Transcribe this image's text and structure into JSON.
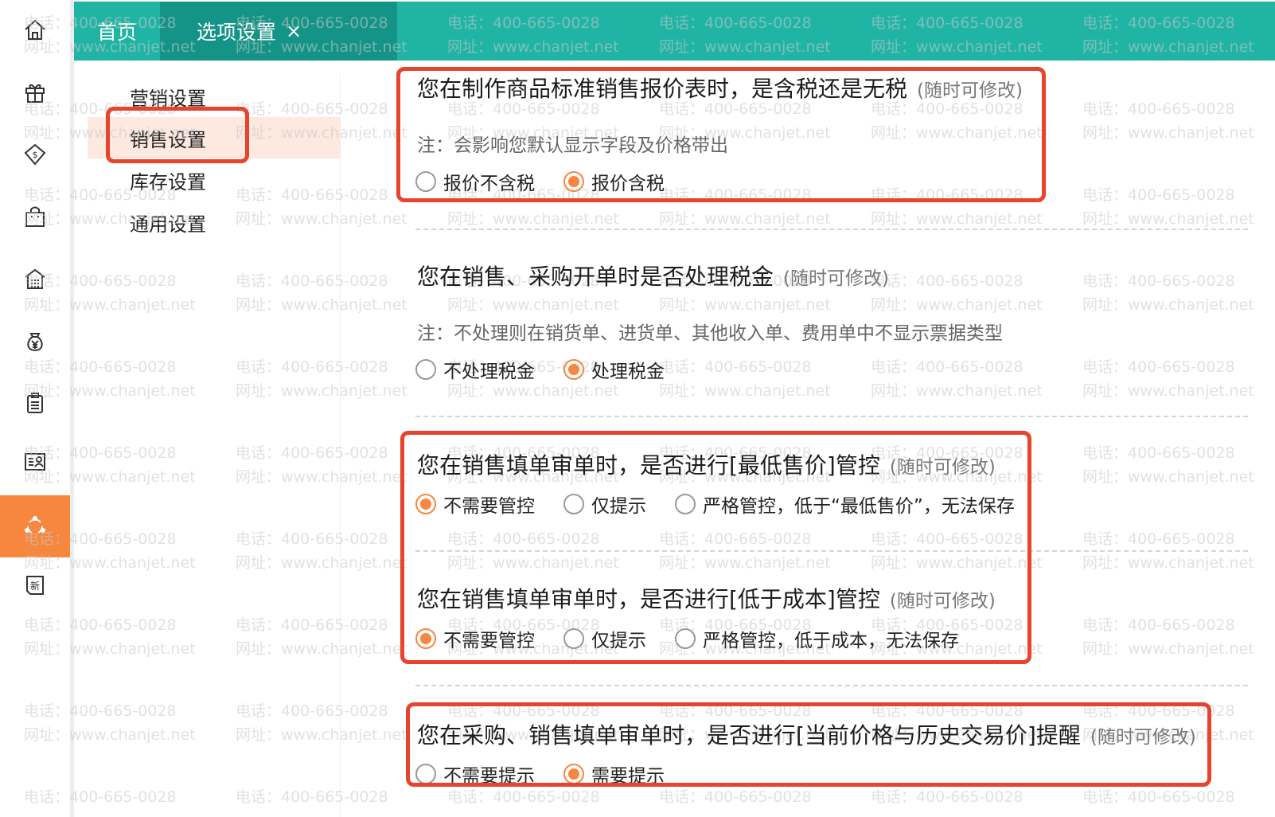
{
  "tabs": {
    "home": "首页",
    "active": "选项设置",
    "close": "×"
  },
  "sidebar_icons": [
    {
      "name": "home-icon"
    },
    {
      "name": "gift-icon"
    },
    {
      "name": "money-bag-icon"
    },
    {
      "name": "shopping-bag-icon"
    },
    {
      "name": "warehouse-icon"
    },
    {
      "name": "yen-bag-icon"
    },
    {
      "name": "clipboard-icon"
    },
    {
      "name": "contact-card-icon"
    },
    {
      "name": "settings-loop-icon",
      "active": true
    },
    {
      "name": "new-badge-icon",
      "text": "新"
    }
  ],
  "nav": {
    "items": [
      {
        "label": "营销设置"
      },
      {
        "label": "销售设置",
        "selected": true
      },
      {
        "label": "库存设置"
      },
      {
        "label": "通用设置"
      }
    ]
  },
  "watermark": {
    "phone": "电话：400-665-0028",
    "site": "网址：www.chanjet.net"
  },
  "sections": [
    {
      "title": "您在制作商品标准销售报价表时，是含税还是无税",
      "hint": "(随时可修改)",
      "note": "注：会影响您默认显示字段及价格带出",
      "options": [
        {
          "label": "报价不含税",
          "checked": false
        },
        {
          "label": "报价含税",
          "checked": true
        }
      ]
    },
    {
      "title": "您在销售、采购开单时是否处理税金",
      "hint": "(随时可修改)",
      "note": "注：不处理则在销货单、进货单、其他收入单、费用单中不显示票据类型",
      "options": [
        {
          "label": "不处理税金",
          "checked": false
        },
        {
          "label": "处理税金",
          "checked": true
        }
      ]
    },
    {
      "title": "您在销售填单审单时，是否进行[最低售价]管控",
      "hint": "(随时可修改)",
      "options": [
        {
          "label": "不需要管控",
          "checked": true
        },
        {
          "label": "仅提示",
          "checked": false
        },
        {
          "label": "严格管控，低于“最低售价”，无法保存",
          "checked": false
        }
      ]
    },
    {
      "title": "您在销售填单审单时，是否进行[低于成本]管控",
      "hint": "(随时可修改)",
      "options": [
        {
          "label": "不需要管控",
          "checked": true
        },
        {
          "label": "仅提示",
          "checked": false
        },
        {
          "label": "严格管控，低于成本，无法保存",
          "checked": false
        }
      ]
    },
    {
      "title": "您在采购、销售填单审单时，是否进行[当前价格与历史交易价]提醒",
      "hint": "(随时可修改)",
      "options": [
        {
          "label": "不需要提示",
          "checked": false
        },
        {
          "label": "需要提示",
          "checked": true
        }
      ]
    }
  ],
  "colors": {
    "tabbar": "#20b4a5",
    "tab_active": "#139486",
    "accent": "#f7863f",
    "highlight": "#e8432c",
    "nav_selected": "#fde9df"
  }
}
